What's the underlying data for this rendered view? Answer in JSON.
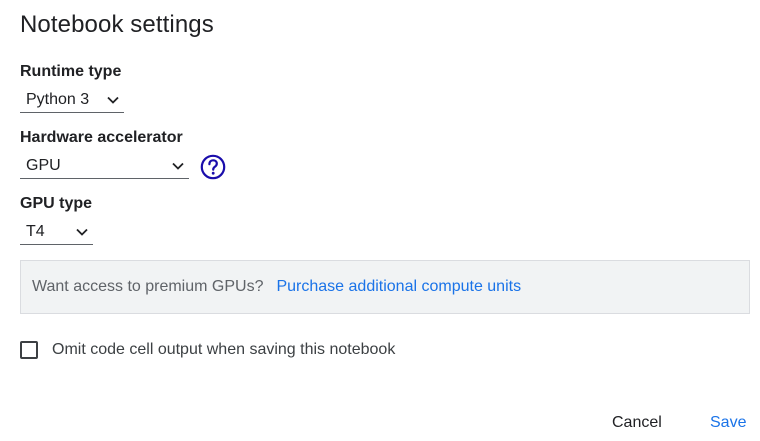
{
  "dialog": {
    "title": "Notebook settings"
  },
  "runtime_type": {
    "label": "Runtime type",
    "value": "Python 3"
  },
  "hardware_accelerator": {
    "label": "Hardware accelerator",
    "value": "GPU",
    "help_icon": "help-circle-icon"
  },
  "gpu_type": {
    "label": "GPU type",
    "value": "T4"
  },
  "banner": {
    "text": "Want access to premium GPUs?",
    "link": "Purchase additional compute units"
  },
  "omit_output": {
    "label": "Omit code cell output when saving this notebook",
    "checked": false
  },
  "actions": {
    "cancel": "Cancel",
    "save": "Save"
  },
  "colors": {
    "accent": "#1a73e8",
    "help_icon": "#1a0dab",
    "banner_bg": "#f1f3f4"
  }
}
